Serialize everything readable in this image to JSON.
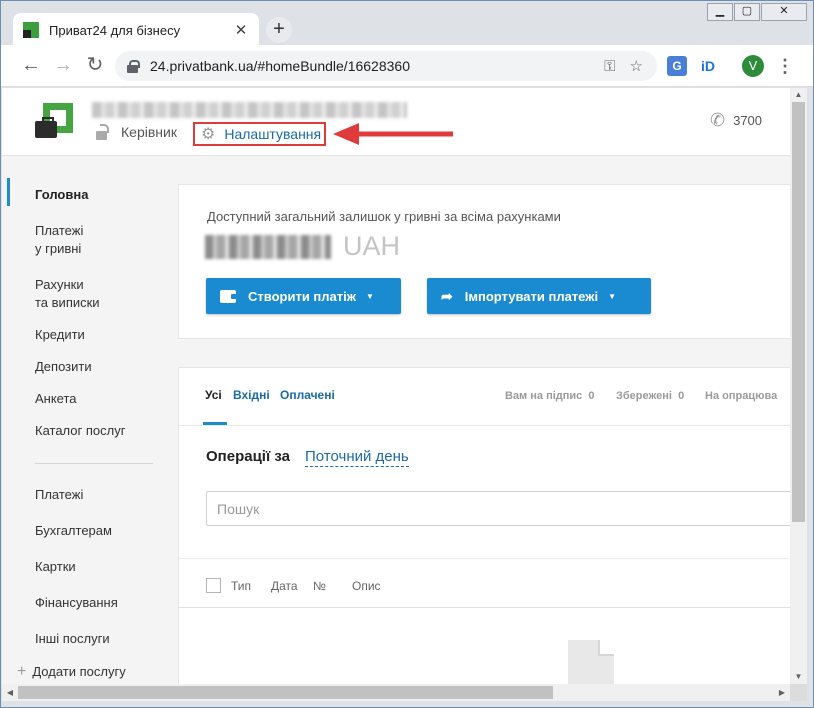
{
  "browser": {
    "tab_title": "Приват24 для бізнесу",
    "tab_close": "✕",
    "new_tab": "+",
    "url": "24.privatbank.ua/#homeBundle/16628360",
    "nav": {
      "back": "←",
      "forward": "→",
      "reload": "↻"
    },
    "avatar_letter": "V",
    "window_controls": {
      "minimize": "▁",
      "maximize": "▢",
      "close": "✕"
    },
    "extensions": {
      "translate": "G",
      "id": "iD"
    }
  },
  "header": {
    "role": "Керівник",
    "settings_label": "Налаштування",
    "phone_number": "3700",
    "highlight_color": "#e03b3b"
  },
  "sidebar": {
    "items": [
      {
        "label": "Головна",
        "active": true
      },
      {
        "label": "Платежі\nу гривні"
      },
      {
        "label": "Рахунки\nта виписки"
      },
      {
        "label": "Кредити"
      },
      {
        "label": "Депозити"
      },
      {
        "label": "Анкета"
      },
      {
        "label": "Каталог послуг"
      },
      {
        "label": "Платежі"
      },
      {
        "label": "Бухгалтерам"
      },
      {
        "label": "Картки"
      },
      {
        "label": "Фінансування"
      },
      {
        "label": "Інші послуги"
      }
    ],
    "add_service": "Додати послугу"
  },
  "balance": {
    "caption": "Доступний загальний залишок у гривні за всіма рахунками",
    "currency": "UAH",
    "create_payment_button": "Створити платіж",
    "import_payments_button": "Імпортувати платежі",
    "accent_color": "#1a8ad1"
  },
  "operations": {
    "tabs": [
      "Усі",
      "Вхідні",
      "Оплачені"
    ],
    "filters": [
      {
        "label": "Вам на підпис",
        "count": "0"
      },
      {
        "label": "Збережені",
        "count": "0"
      },
      {
        "label": "На опрацюва",
        "count": ""
      }
    ],
    "period_label": "Операції за",
    "period_value": "Поточний день",
    "search_placeholder": "Пошук",
    "columns": [
      "Тип",
      "Дата",
      "№",
      "Опис"
    ]
  }
}
